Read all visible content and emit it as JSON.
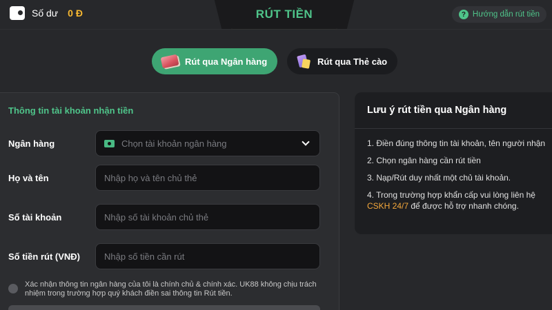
{
  "header": {
    "balance_label": "Số dư",
    "balance_value": "0 Đ",
    "title": "RÚT TIỀN",
    "guide_label": "Hướng dẫn rút tiền"
  },
  "methods": [
    {
      "label": "Rút qua Ngân hàng",
      "active": true,
      "icon": "bank-card-icon"
    },
    {
      "label": "Rút qua Thẻ cào",
      "active": false,
      "icon": "scratch-card-icon"
    }
  ],
  "form": {
    "heading": "Thông tin tài khoản nhận tiền",
    "bank_label": "Ngân hàng",
    "bank_placeholder": "Chọn tài khoản ngân hàng",
    "name_label": "Họ và tên",
    "name_placeholder": "Nhập họ và tên chủ thẻ",
    "account_label": "Số tài khoản",
    "account_placeholder": "Nhập số tài khoản chủ thẻ",
    "amount_label": "Số tiền rút (VNĐ)",
    "amount_placeholder": "Nhập số tiền cần rút",
    "confirm_text": "Xác nhận thông tin ngân hàng của tôi là chính chủ & chính xác. UK88 không chịu trách nhiệm trong trường hợp quý khách điền sai thông tin Rút tiền."
  },
  "notes": {
    "title": "Lưu ý rút tiền qua Ngân hàng",
    "item1": "1. Điền đúng thông tin tài khoản, tên người nhận",
    "item2": "2. Chọn ngân hàng cần rút tiền",
    "item3": "3. Nạp/Rút duy nhất một chủ tài khoản.",
    "item4_prefix": "4. Trong trường hợp khẩn cấp vui lòng liên hệ ",
    "item4_link": "CSKH 24/7",
    "item4_suffix": " để được hỗ trợ nhanh chóng."
  },
  "colors": {
    "accent": "#4fc48a",
    "active_tab": "#3ea573",
    "balance": "#f5b731",
    "hotline": "#f5a83b",
    "background": "#27282b"
  }
}
